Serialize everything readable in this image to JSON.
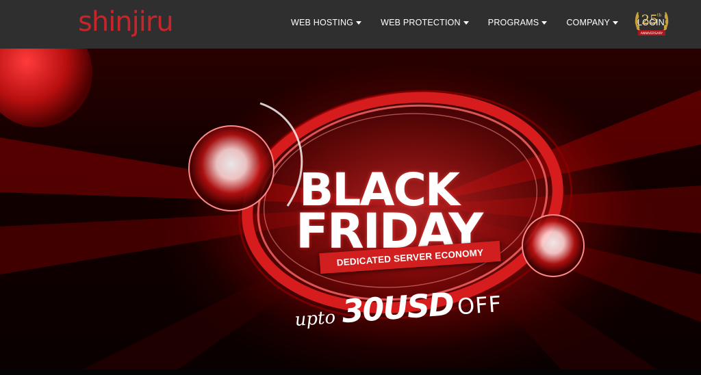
{
  "brand": {
    "name": "shinjiru"
  },
  "nav": {
    "items": [
      {
        "label": "WEB HOSTING",
        "has_dropdown": true
      },
      {
        "label": "WEB PROTECTION",
        "has_dropdown": true
      },
      {
        "label": "PROGRAMS",
        "has_dropdown": true
      },
      {
        "label": "COMPANY",
        "has_dropdown": true
      },
      {
        "label": "LOGIN",
        "has_dropdown": false
      }
    ]
  },
  "anniversary_badge": {
    "number": "25",
    "suffix": "th",
    "text": "ANNIVERSARY",
    "icon": "laurel-wreath-icon"
  },
  "hero": {
    "line1": "BLACK",
    "line2": "FRIDAY",
    "ribbon": "DEDICATED SERVER ECONOMY",
    "promo_prefix": "upto",
    "promo_amount": "30USD",
    "promo_suffix": "OFF"
  },
  "colors": {
    "header_bg": "#2f2f2f",
    "brand_red": "#c8252b",
    "hero_red": "#d11f1f",
    "gold": "#c9a23a"
  }
}
